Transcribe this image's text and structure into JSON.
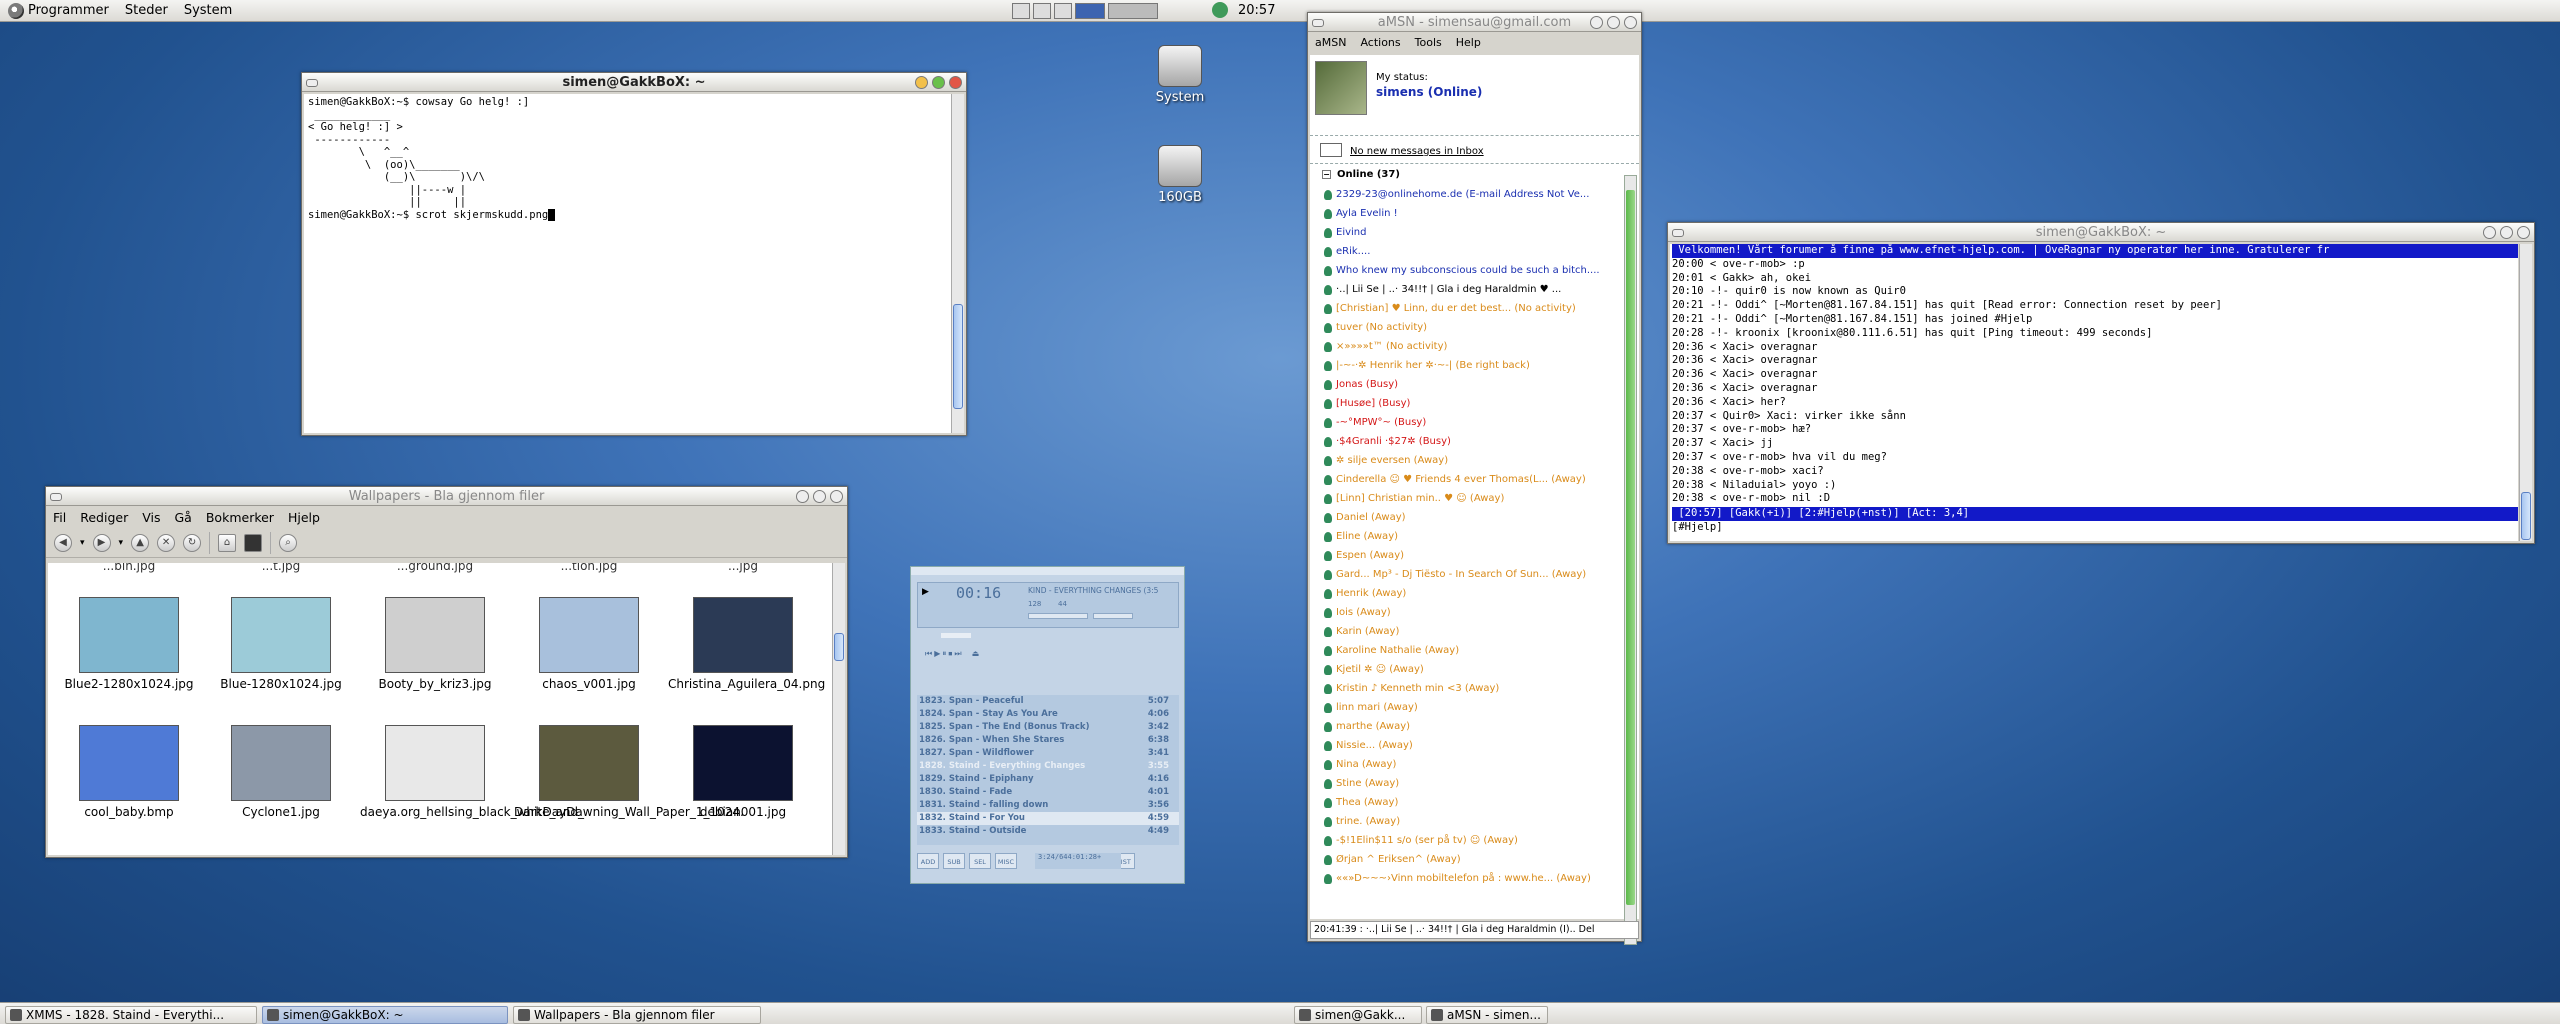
{
  "top_panel": {
    "menus": [
      "Programmer",
      "Steder",
      "System"
    ],
    "clock": "20:57"
  },
  "desktop_icons": [
    {
      "label": "System"
    },
    {
      "label": "160GB"
    }
  ],
  "terminal": {
    "title": "simen@GakkBoX: ~",
    "lines": [
      "simen@GakkBoX:~$ cowsay Go helg! :]",
      " ____________",
      "< Go helg! :] >",
      " ------------",
      "        \\   ^__^",
      "         \\  (oo)\\_______",
      "            (__)\\       )\\/\\",
      "                ||----w |",
      "                ||     ||",
      "simen@GakkBoX:~$ scrot skjermskudd.png"
    ]
  },
  "file_manager": {
    "title": "Wallpapers - Bla gjennom filer",
    "menu": [
      "Fil",
      "Rediger",
      "Vis",
      "Gå",
      "Bokmerker",
      "Hjelp"
    ],
    "partial_top": [
      "...bin.jpg",
      "...t.jpg",
      "...ground.jpg",
      "...tion.jpg",
      "...jpg"
    ],
    "files": [
      {
        "name": "Blue2-1280x1024.jpg",
        "color": "#7fb6cf"
      },
      {
        "name": "Blue-1280x1024.jpg",
        "color": "#9ccbd8"
      },
      {
        "name": "Booty_by_kriz3.jpg",
        "color": "#cfcfcf"
      },
      {
        "name": "chaos_v001.jpg",
        "color": "#a8c0dc"
      },
      {
        "name": "Christina_Aguilera_04.png",
        "color": "#2b3a55"
      },
      {
        "name": "cool_baby.bmp",
        "color": "#4f7ad6"
      },
      {
        "name": "Cyclone1.jpg",
        "color": "#8c98a8"
      },
      {
        "name": "daeya.org_hellsing_black_white_and_",
        "color": "#e8e8e8"
      },
      {
        "name": "DarkDayDawning_Wall_Paper_1_1024.",
        "color": "#5c5a3e"
      },
      {
        "name": "debian001.jpg",
        "color": "#0c1230"
      }
    ]
  },
  "xmms": {
    "time": "00:16",
    "song_title": "XMMS - 1828. Staind - Everything Changes",
    "scroll_text": "KIND - EVERYTHING CHANGES (3:5",
    "kbps": "128",
    "khz": "44",
    "playlist": [
      {
        "title": "1823. Span - Peaceful",
        "time": "5:07"
      },
      {
        "title": "1824. Span - Stay As You Are",
        "time": "4:06"
      },
      {
        "title": "1825. Span - The End (Bonus Track)",
        "time": "3:42"
      },
      {
        "title": "1826. Span - When She Stares",
        "time": "6:38"
      },
      {
        "title": "1827. Span - Wildflower",
        "time": "3:41"
      },
      {
        "title": "1828. Staind - Everything Changes",
        "time": "3:55"
      },
      {
        "title": "1829. Staind - Epiphany",
        "time": "4:16"
      },
      {
        "title": "1830. Staind - Fade",
        "time": "4:01"
      },
      {
        "title": "1831. Staind - falling down",
        "time": "3:56"
      },
      {
        "title": "1832. Staind - For You",
        "time": "4:59"
      },
      {
        "title": "1833. Staind - Outside",
        "time": "4:49"
      }
    ],
    "buttons": [
      "ADD",
      "SUB",
      "SEL",
      "MISC",
      "LIST"
    ],
    "total": "3:24/644:01:28+"
  },
  "amsn": {
    "title": "aMSN - simensau@gmail.com",
    "menu": [
      "aMSN",
      "Actions",
      "Tools",
      "Help"
    ],
    "status_label": "My status:",
    "status_value": "simens (Online)",
    "inbox": "No new messages in Inbox",
    "group": "Online (37)",
    "contacts": [
      {
        "name": "2329-23@onlinehome.de (E-mail Address Not Ve...",
        "state": "on"
      },
      {
        "name": "Ayla Evelin !",
        "state": "on"
      },
      {
        "name": "Eivind",
        "state": "on"
      },
      {
        "name": "eRik....",
        "state": "on"
      },
      {
        "name": "Who knew my subconscious could be such a bitch....",
        "state": "on"
      },
      {
        "name": "·..| Lii Se | ..· 34!!†  | Gla i deg Haraldmin ♥ ...",
        "state": "plain"
      },
      {
        "name": "[Christian] ♥ Linn, du er det best... (No activity)",
        "state": "away"
      },
      {
        "name": "tuver (No activity)",
        "state": "away"
      },
      {
        "name": "×»»»»t™ (No activity)",
        "state": "away"
      },
      {
        "name": "|-~-·✲ Henrik her ✲·~-| (Be right back)",
        "state": "away"
      },
      {
        "name": "Jonas (Busy)",
        "state": "busy"
      },
      {
        "name": "[Husøe] (Busy)",
        "state": "busy"
      },
      {
        "name": "-~°MPW°~ (Busy)",
        "state": "busy"
      },
      {
        "name": "·$4Granli ·$27✲ (Busy)",
        "state": "busy"
      },
      {
        "name": "✲ silje eversen (Away)",
        "state": "away"
      },
      {
        "name": "Cinderella ☺ ♥ Friends 4 ever Thomas(L... (Away)",
        "state": "away"
      },
      {
        "name": "[Linn] Christian min.. ♥ ☺ (Away)",
        "state": "away"
      },
      {
        "name": "Daniel (Away)",
        "state": "away"
      },
      {
        "name": "Eline (Away)",
        "state": "away"
      },
      {
        "name": "Espen (Away)",
        "state": "away"
      },
      {
        "name": "Gard... Mp³ - Dj Tiësto - In Search Of Sun... (Away)",
        "state": "away"
      },
      {
        "name": "Henrik (Away)",
        "state": "away"
      },
      {
        "name": "Iois (Away)",
        "state": "away"
      },
      {
        "name": "Karin (Away)",
        "state": "away"
      },
      {
        "name": "Karoline Nathalie (Away)",
        "state": "away"
      },
      {
        "name": "Kjetil ✲ ☺ (Away)",
        "state": "away"
      },
      {
        "name": "Kristin ♪ Kenneth min <3 (Away)",
        "state": "away"
      },
      {
        "name": "linn mari (Away)",
        "state": "away"
      },
      {
        "name": "marthe (Away)",
        "state": "away"
      },
      {
        "name": "Nissie... (Away)",
        "state": "away"
      },
      {
        "name": "Nina (Away)",
        "state": "away"
      },
      {
        "name": "Stine (Away)",
        "state": "away"
      },
      {
        "name": "Thea (Away)",
        "state": "away"
      },
      {
        "name": "trine. (Away)",
        "state": "away"
      },
      {
        "name": "-$!1Elin$11         s/o (ser på tv) ☺ (Away)",
        "state": "away"
      },
      {
        "name": "Ørjan ^ Eriksen^ (Away)",
        "state": "away"
      },
      {
        "name": "««»D~~~›Vinn mobiltelefon på : www.he... (Away)",
        "state": "away"
      }
    ],
    "status_bar": "20:41:39 : ·..| Lii Se | ..· 34!!† | Gla i deg Haraldmin (I).. Del"
  },
  "irc": {
    "title": "simen@GakkBoX: ~",
    "topic": " Velkommen! Vårt forumer å finne på www.efnet-hjelp.com. | OveRagnar ny operatør her inne. Gratulerer fr",
    "lines": [
      "20:00 < ove-r-mob> :p",
      "20:01 < Gakk> ah, okei",
      "20:10 -!- quir0 is now known as Quir0",
      "20:21 -!- Oddi^ [~Morten@81.167.84.151] has quit [Read error: Connection reset by peer]",
      "20:21 -!- Oddi^ [~Morten@81.167.84.151] has joined #Hjelp",
      "20:28 -!- kroonix [kroonix@80.111.6.51] has quit [Ping timeout: 499 seconds]",
      "20:36 < Xaci> overagnar",
      "20:36 < Xaci> overagnar",
      "20:36 < Xaci> overagnar",
      "20:36 < Xaci> overagnar",
      "20:36 < Xaci> her?",
      "20:37 < Quir0> Xaci: virker ikke sånn",
      "20:37 < ove-r-mob> hæ?",
      "20:37 < Xaci> jj",
      "20:37 < ove-r-mob> hva vil du meg?",
      "20:38 < ove-r-mob> xaci?",
      "20:38 < Niladuial> yoyo :)",
      "20:38 < ove-r-mob> nil :D"
    ],
    "statusline": " [20:57] [Gakk(+i)] [2:#Hjelp(+nst)] [Act: 3,4]",
    "input": "[#Hjelp] "
  },
  "taskbar_left": [
    {
      "label": "XMMS - 1828. Staind - Everythi...",
      "active": false
    },
    {
      "label": "simen@GakkBoX: ~",
      "active": true
    },
    {
      "label": "Wallpapers - Bla gjennom filer",
      "active": false
    }
  ],
  "taskbar_right": [
    {
      "label": "simen@Gakk...",
      "active": false
    },
    {
      "label": "aMSN - simen...",
      "active": false
    }
  ]
}
